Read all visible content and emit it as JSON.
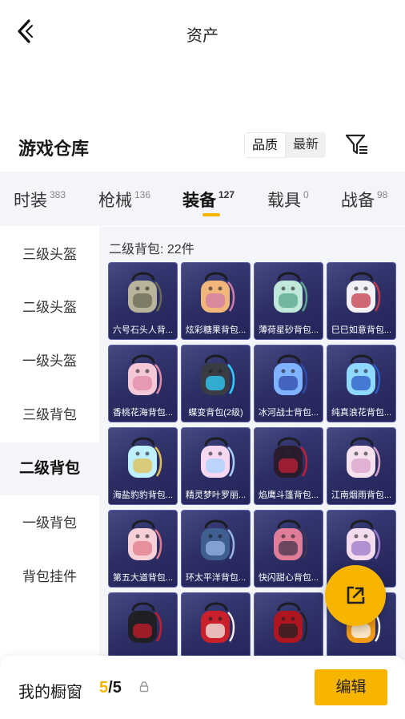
{
  "header": {
    "title": "资产"
  },
  "warehouse": {
    "title": "游戏仓库",
    "sort_options": [
      "品质",
      "最新"
    ],
    "active_sort": "品质"
  },
  "tabs": [
    {
      "label": "时装",
      "count": "383"
    },
    {
      "label": "枪械",
      "count": "136"
    },
    {
      "label": "装备",
      "count": "127",
      "active": true
    },
    {
      "label": "载具",
      "count": "0"
    },
    {
      "label": "战备",
      "count": "98"
    }
  ],
  "sidebar": {
    "items": [
      "三级头盔",
      "二级头盔",
      "一级头盔",
      "三级背包",
      "二级背包",
      "一级背包",
      "背包挂件"
    ],
    "active": "二级背包"
  },
  "panel": {
    "count_text": "二级背包: 22件"
  },
  "items": [
    {
      "name": "六号石头人背...",
      "icon": "stone-golem-backpack"
    },
    {
      "name": "炫彩糖果背包...",
      "icon": "candy-backpack"
    },
    {
      "name": "薄荷星砂背包...",
      "icon": "mint-star-backpack"
    },
    {
      "name": "巳巳如意背包...",
      "icon": "snake-backpack"
    },
    {
      "name": "香桃花海背包...",
      "icon": "peach-backpack"
    },
    {
      "name": "蝶变背包(2级)",
      "icon": "butterfly-backpack"
    },
    {
      "name": "冰河战士背包...",
      "icon": "glacier-warrior-backpack"
    },
    {
      "name": "纯真浪花背包...",
      "icon": "wave-drink-backpack"
    },
    {
      "name": "海盐豹豹背包...",
      "icon": "seal-backpack"
    },
    {
      "name": "精灵梦叶罗丽...",
      "icon": "fairy-heart-backpack"
    },
    {
      "name": "焰鹰斗篷背包...",
      "icon": "flame-eagle-backpack"
    },
    {
      "name": "江南烟雨背包...",
      "icon": "rain-bunny-backpack"
    },
    {
      "name": "第五大道背包...",
      "icon": "fifth-avenue-backpack"
    },
    {
      "name": "环太平洋背包...",
      "icon": "pacific-rim-backpack"
    },
    {
      "name": "快闪甜心背包...",
      "icon": "sweetheart-backpack"
    },
    {
      "name": "",
      "icon": "winged-heart-backpack"
    },
    {
      "name": "",
      "icon": "black-red-backpack"
    },
    {
      "name": "",
      "icon": "red-white-backpack"
    },
    {
      "name": "",
      "icon": "red-bomb-backpack"
    },
    {
      "name": "",
      "icon": "orange-backpack"
    }
  ],
  "bottom": {
    "label": "我的橱窗",
    "current": "5",
    "separator": "/",
    "total": "5",
    "edit_label": "编辑"
  },
  "colors": {
    "accent": "#f7b500",
    "card_bg": "#2b2d63",
    "card_border": "#5c61b0"
  }
}
